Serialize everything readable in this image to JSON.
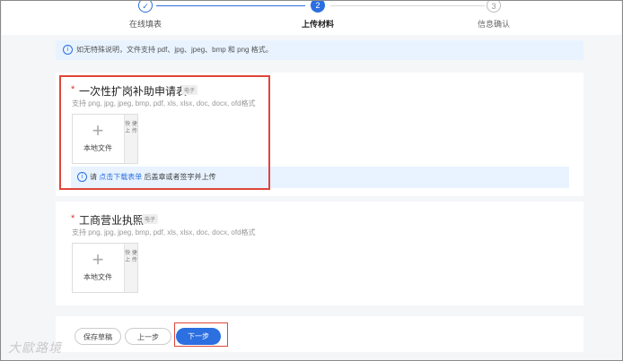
{
  "steps": [
    {
      "num": "✓",
      "label": "在线填表",
      "state": "done"
    },
    {
      "num": "2",
      "label": "上传材料",
      "state": "active"
    },
    {
      "num": "3",
      "label": "信息确认",
      "state": "todo"
    }
  ],
  "info_text": "如无特殊说明，文件支持 pdf、jpg、jpeg、bmp 和 png 格式。",
  "sections": [
    {
      "required_mark": "*",
      "title": "一次性扩岗补助申请表",
      "tag": "电子",
      "formats": "支持 png, jpg, jpeg, bmp, pdf, xls, xlsx, doc, docx, ofd格式",
      "upload_label": "本地文件",
      "quick_label": "快 捷 上 传",
      "notice_prefix": "请",
      "notice_link": "点击下载表单",
      "notice_suffix": "后盖章或者签字并上传"
    },
    {
      "required_mark": "*",
      "title": "工商营业执照",
      "tag": "电子",
      "formats": "支持 png, jpg, jpeg, bmp, pdf, xls, xlsx, doc, docx, ofd格式",
      "upload_label": "本地文件",
      "quick_label": "快 捷 上 传"
    }
  ],
  "buttons": {
    "save": "保存草稿",
    "prev": "上一步",
    "next": "下一步"
  },
  "watermark": "大歐路境",
  "colors": {
    "primary": "#2b6fe0",
    "highlight_box": "#e0463a"
  }
}
